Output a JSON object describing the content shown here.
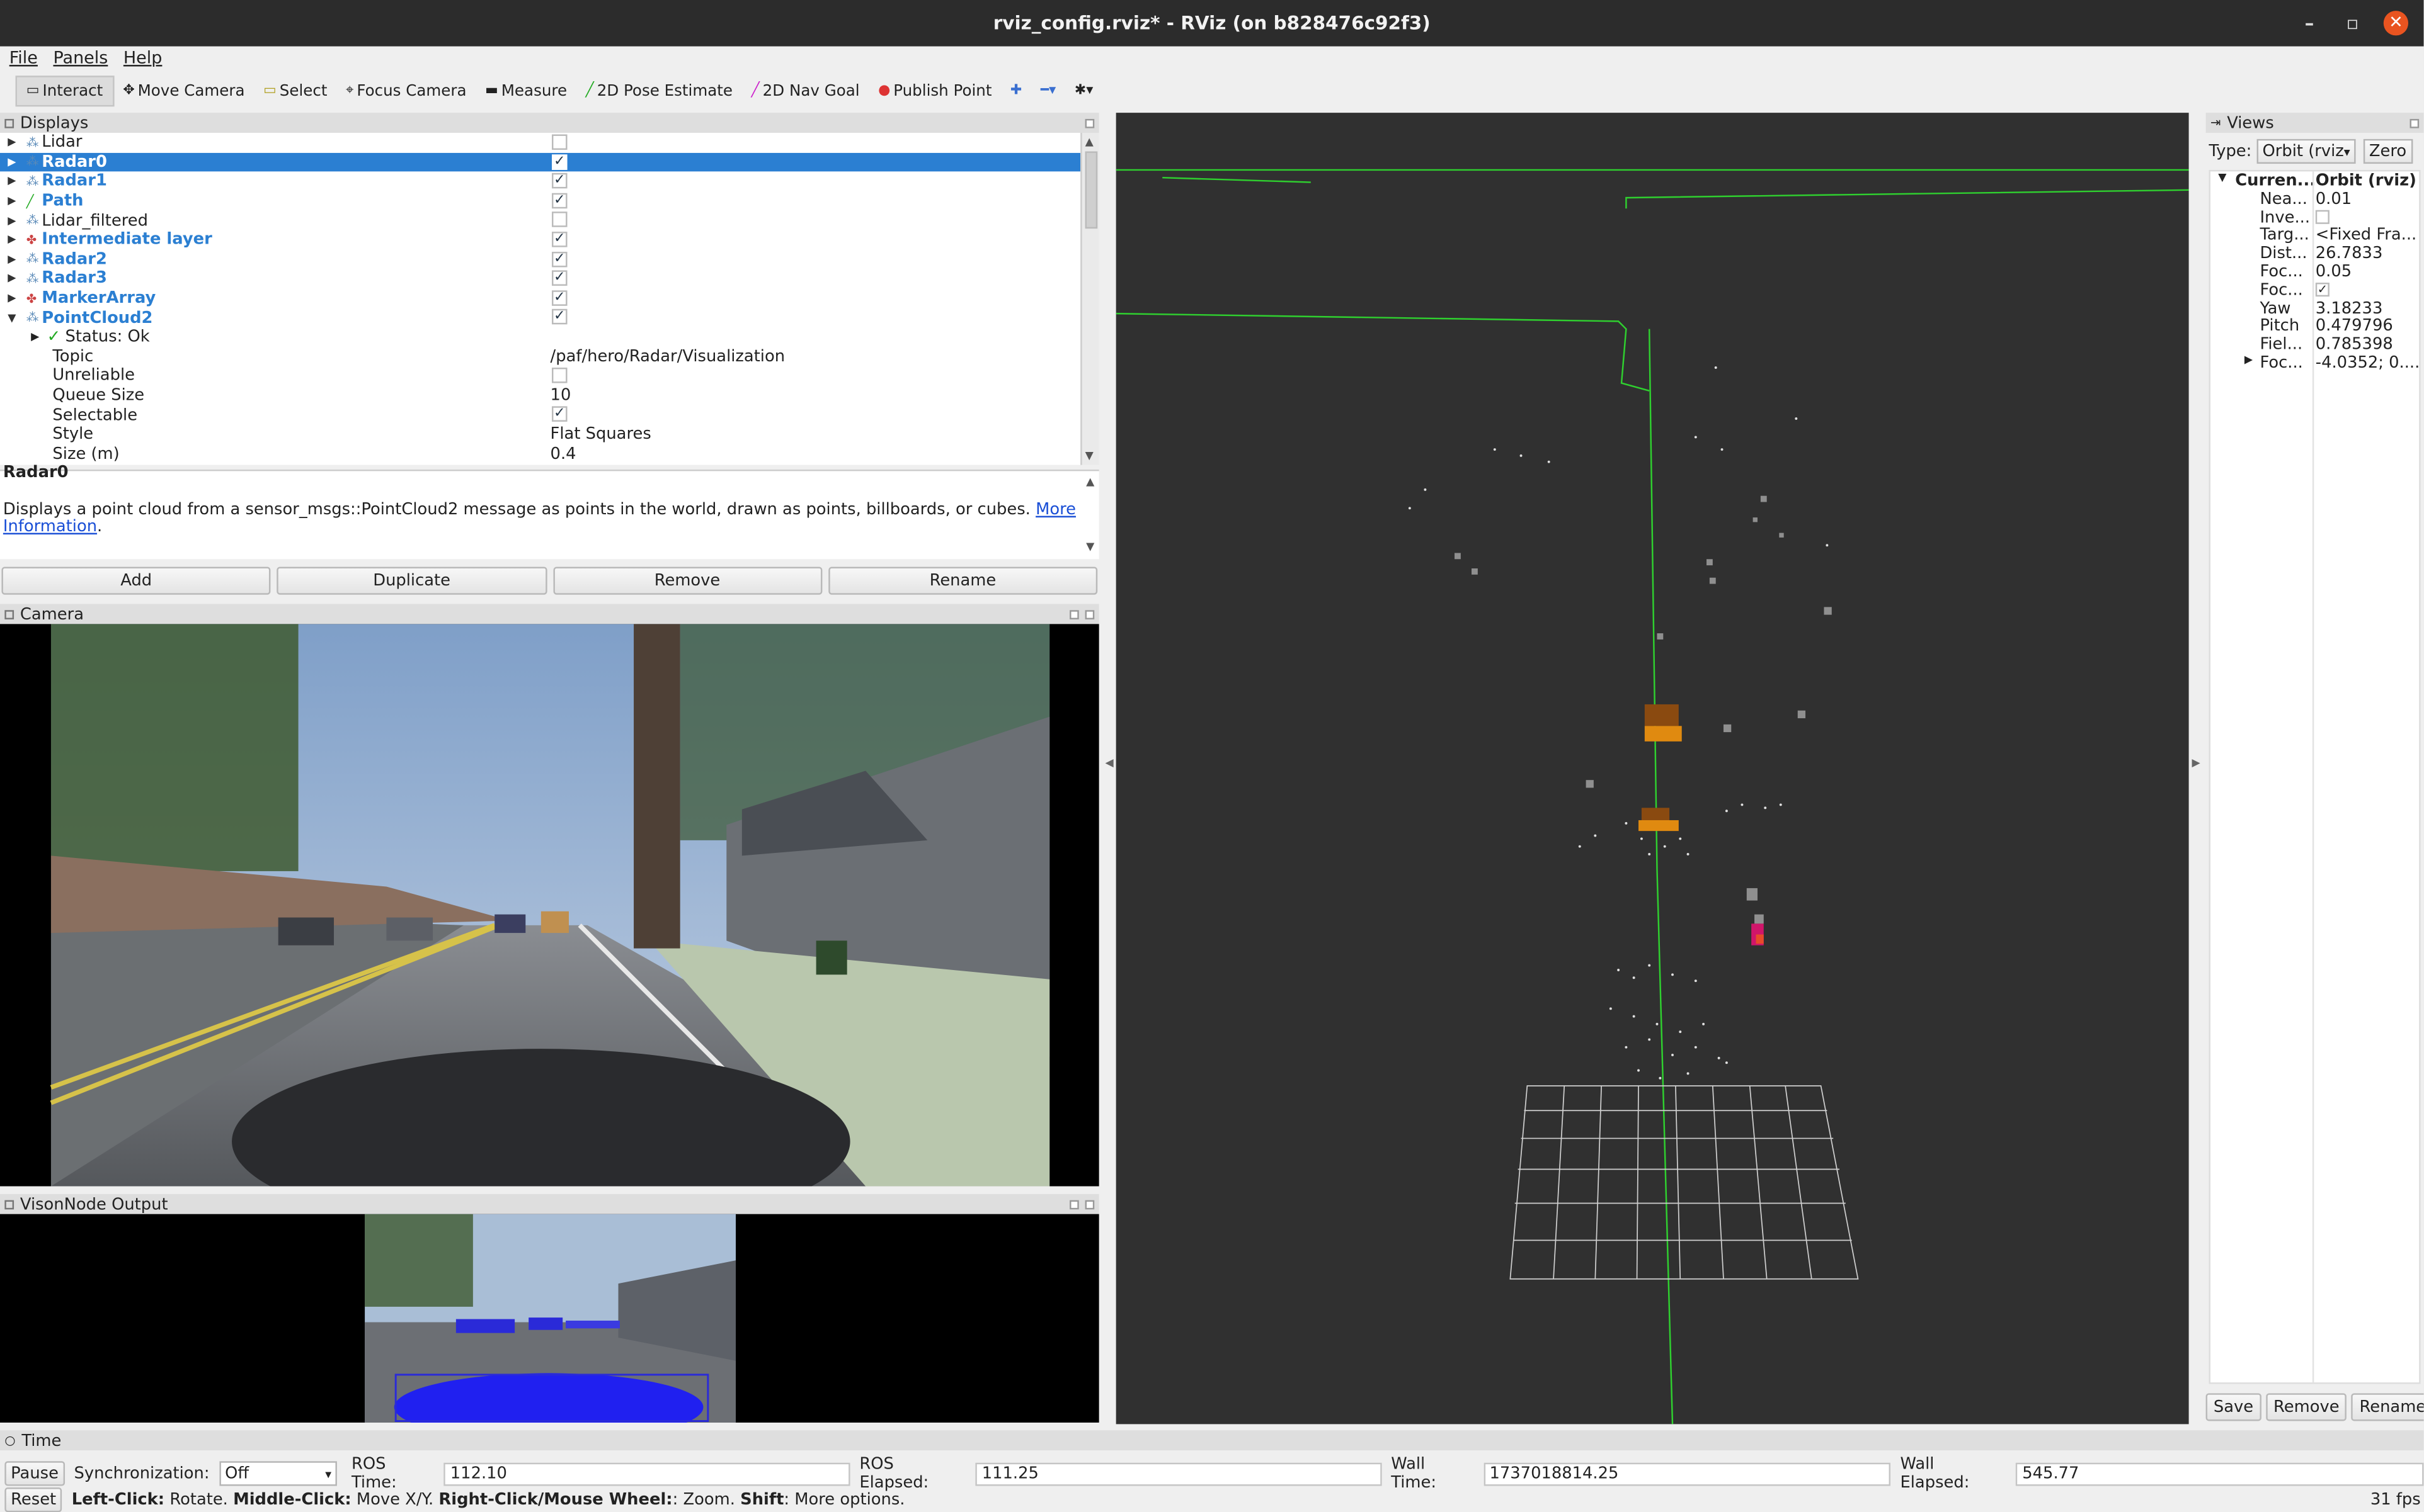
{
  "window": {
    "title": "rviz_config.rviz* - RViz (on b828476c92f3)"
  },
  "menu": [
    "File",
    "Panels",
    "Help"
  ],
  "toolbar": {
    "tools": [
      {
        "label": "Interact",
        "icon": "interact-icon",
        "active": true
      },
      {
        "label": "Move Camera",
        "icon": "move-camera-icon"
      },
      {
        "label": "Select",
        "icon": "select-icon"
      },
      {
        "label": "Focus Camera",
        "icon": "focus-camera-icon"
      },
      {
        "label": "Measure",
        "icon": "measure-icon"
      },
      {
        "label": "2D Pose Estimate",
        "icon": "pose-estimate-icon"
      },
      {
        "label": "2D Nav Goal",
        "icon": "nav-goal-icon"
      },
      {
        "label": "Publish Point",
        "icon": "publish-point-icon"
      }
    ]
  },
  "displays": {
    "title": "Displays",
    "items": [
      {
        "name": "Lidar",
        "checked": false,
        "bold": false
      },
      {
        "name": "Radar0",
        "checked": true,
        "bold": true,
        "selected": true
      },
      {
        "name": "Radar1",
        "checked": true,
        "bold": true
      },
      {
        "name": "Path",
        "checked": true,
        "bold": true
      },
      {
        "name": "Lidar_filtered",
        "checked": false,
        "bold": false
      },
      {
        "name": "Intermediate layer",
        "checked": true,
        "bold": true
      },
      {
        "name": "Radar2",
        "checked": true,
        "bold": true
      },
      {
        "name": "Radar3",
        "checked": true,
        "bold": true
      },
      {
        "name": "MarkerArray",
        "checked": true,
        "bold": true
      },
      {
        "name": "PointCloud2",
        "checked": true,
        "bold": true,
        "expanded": true
      }
    ],
    "status": "Status: Ok",
    "properties": [
      {
        "key": "Topic",
        "value": "/paf/hero/Radar/Visualization"
      },
      {
        "key": "Unreliable",
        "checkbox": false
      },
      {
        "key": "Queue Size",
        "value": "10"
      },
      {
        "key": "Selectable",
        "checkbox": true
      },
      {
        "key": "Style",
        "value": "Flat Squares"
      },
      {
        "key": "Size (m)",
        "value": "0.4"
      }
    ]
  },
  "description": {
    "title": "Radar0",
    "text": "Displays a point cloud from a sensor_msgs::PointCloud2 message as points in the world, drawn as points, billboards, or cubes.",
    "link1": "More",
    "link2": "Information",
    "after": "."
  },
  "display_buttons": {
    "add": "Add",
    "duplicate": "Duplicate",
    "remove": "Remove",
    "rename": "Rename"
  },
  "camera": {
    "title": "Camera"
  },
  "vision": {
    "title": "VisonNode Output"
  },
  "views": {
    "title": "Views",
    "type_label": "Type:",
    "type_value": "Orbit (rviz",
    "zero": "Zero",
    "current_key": "Curren...",
    "current_value": "Orbit (rviz)",
    "props": [
      {
        "k": "Nea...",
        "v": "0.01"
      },
      {
        "k": "Inve...",
        "check": false
      },
      {
        "k": "Targ...",
        "v": "<Fixed Fra..."
      },
      {
        "k": "Dist...",
        "v": "26.7833"
      },
      {
        "k": "Foc...",
        "v": "0.05"
      },
      {
        "k": "Foc...",
        "check": true
      },
      {
        "k": "Yaw",
        "v": "3.18233"
      },
      {
        "k": "Pitch",
        "v": "0.479796"
      },
      {
        "k": "Fiel...",
        "v": "0.785398"
      },
      {
        "k": "Foc...",
        "v": "-4.0352; 0....",
        "expandable": true
      }
    ],
    "save": "Save",
    "remove": "Remove",
    "rename": "Rename"
  },
  "time": {
    "title": "Time",
    "pause": "Pause",
    "sync_label": "Synchronization:",
    "sync_value": "Off",
    "ros_time_label": "ROS Time:",
    "ros_time": "112.10",
    "ros_elapsed_label": "ROS Elapsed:",
    "ros_elapsed": "111.25",
    "wall_time_label": "Wall Time:",
    "wall_time": "1737018814.25",
    "wall_elapsed_label": "Wall Elapsed:",
    "wall_elapsed": "545.77"
  },
  "status": {
    "reset": "Reset",
    "hint_b1": "Left-Click:",
    "hint_t1": " Rotate. ",
    "hint_b2": "Middle-Click:",
    "hint_t2": " Move X/Y. ",
    "hint_b3": "Right-Click/Mouse Wheel:",
    "hint_t3": ": Zoom. ",
    "hint_b4": "Shift",
    "hint_t4": ": More options.",
    "fps": "31 fps"
  },
  "colors": {
    "selection": "#2b7fd2",
    "viewport_bg": "#303030",
    "path_green": "#2fd02f"
  }
}
